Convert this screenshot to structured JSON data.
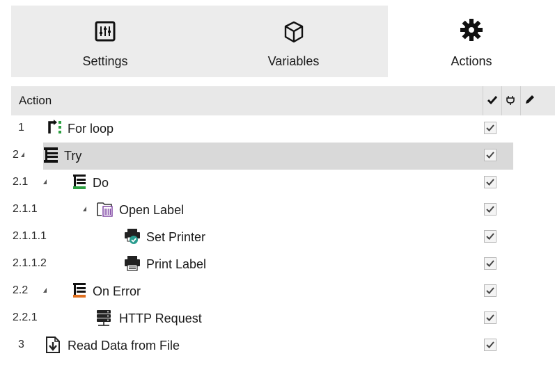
{
  "tabs": [
    {
      "label": "Settings",
      "icon": "settings-sliders-icon"
    },
    {
      "label": "Variables",
      "icon": "cube-icon"
    },
    {
      "label": "Actions",
      "icon": "gear-icon",
      "active": true
    }
  ],
  "grid": {
    "header": {
      "action_label": "Action",
      "columns": [
        {
          "icon": "checkmark-icon"
        },
        {
          "icon": "plug-icon"
        },
        {
          "icon": "pencil-icon"
        }
      ]
    },
    "rows": [
      {
        "num": "1",
        "label": "For loop",
        "icon": "for-loop-icon",
        "checked": true
      },
      {
        "num": "2",
        "label": "Try",
        "icon": "try-icon",
        "checked": true,
        "expanded": true,
        "selected": true
      },
      {
        "num": "2.1",
        "label": "Do",
        "icon": "do-icon",
        "checked": true,
        "expanded": true
      },
      {
        "num": "2.1.1",
        "label": "Open Label",
        "icon": "open-label-icon",
        "checked": true,
        "expanded": true
      },
      {
        "num": "2.1.1.1",
        "label": "Set Printer",
        "icon": "set-printer-icon",
        "checked": true
      },
      {
        "num": "2.1.1.2",
        "label": "Print Label",
        "icon": "printer-icon",
        "checked": true
      },
      {
        "num": "2.2",
        "label": "On Error",
        "icon": "on-error-icon",
        "checked": true,
        "expanded": true
      },
      {
        "num": "2.2.1",
        "label": "HTTP Request",
        "icon": "http-request-icon",
        "checked": true
      },
      {
        "num": "3",
        "label": "Read Data from File",
        "icon": "read-data-from-file-icon",
        "checked": true
      }
    ]
  },
  "colors": {
    "tab_bg": "#ececec",
    "active_tab_bg": "#ffffff",
    "header_bg": "#e8e8e8",
    "selected_row_bg": "#d9d9d9",
    "green_accent": "#2ea043",
    "orange_accent": "#e07020",
    "purple_accent": "#7a3fa0",
    "teal_accent": "#2a9d8f"
  }
}
